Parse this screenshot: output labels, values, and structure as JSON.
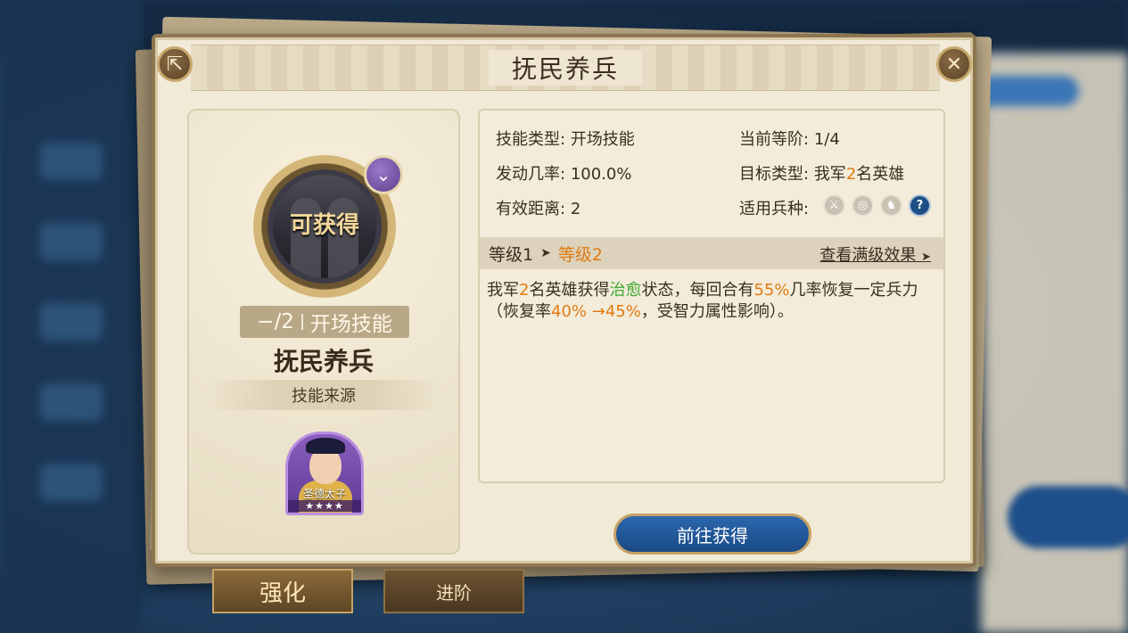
{
  "dialog": {
    "title": "抚民养兵"
  },
  "skill": {
    "status_label": "可获得",
    "level_tag": "−/2",
    "type_tag": "开场技能",
    "name": "抚民养兵",
    "source_label": "技能来源",
    "hero_name": "圣德太子",
    "hero_stars": "★★★★"
  },
  "info": {
    "skill_type_label": "技能类型:",
    "skill_type_value": "开场技能",
    "current_rank_label": "当前等阶:",
    "current_rank_value": "1/4",
    "trigger_rate_label": "发动几率:",
    "trigger_rate_value": "100.0%",
    "target_type_label": "目标类型:",
    "target_type_prefix": "我军",
    "target_type_count": "2",
    "target_type_suffix": "名英雄",
    "range_label": "有效距离:",
    "range_value": "2",
    "troop_label": "适用兵种:",
    "troop_icons": [
      "sword-icon",
      "bow-icon",
      "horse-icon",
      "help-icon"
    ]
  },
  "levels": {
    "current": "等级1",
    "next": "等级2",
    "full_effect_link": "查看满级效果"
  },
  "description": {
    "p1": "我军",
    "n1": "2",
    "p2": "名英雄获得",
    "status": "治愈",
    "p3": "状态，每回合有",
    "rate": "55%",
    "p4": "几率恢复一定兵力（恢复率",
    "heal_from": "40%",
    "heal_arrow": " →",
    "heal_to": "45%",
    "p5": "，受智力属性影响）。"
  },
  "actions": {
    "goto_button": "前往获得"
  },
  "tabs": {
    "strengthen": "强化",
    "advance": "进阶"
  },
  "colors": {
    "highlight_orange": "#e07b12",
    "status_green": "#3eaa32",
    "button_blue": "#1a4a86"
  }
}
